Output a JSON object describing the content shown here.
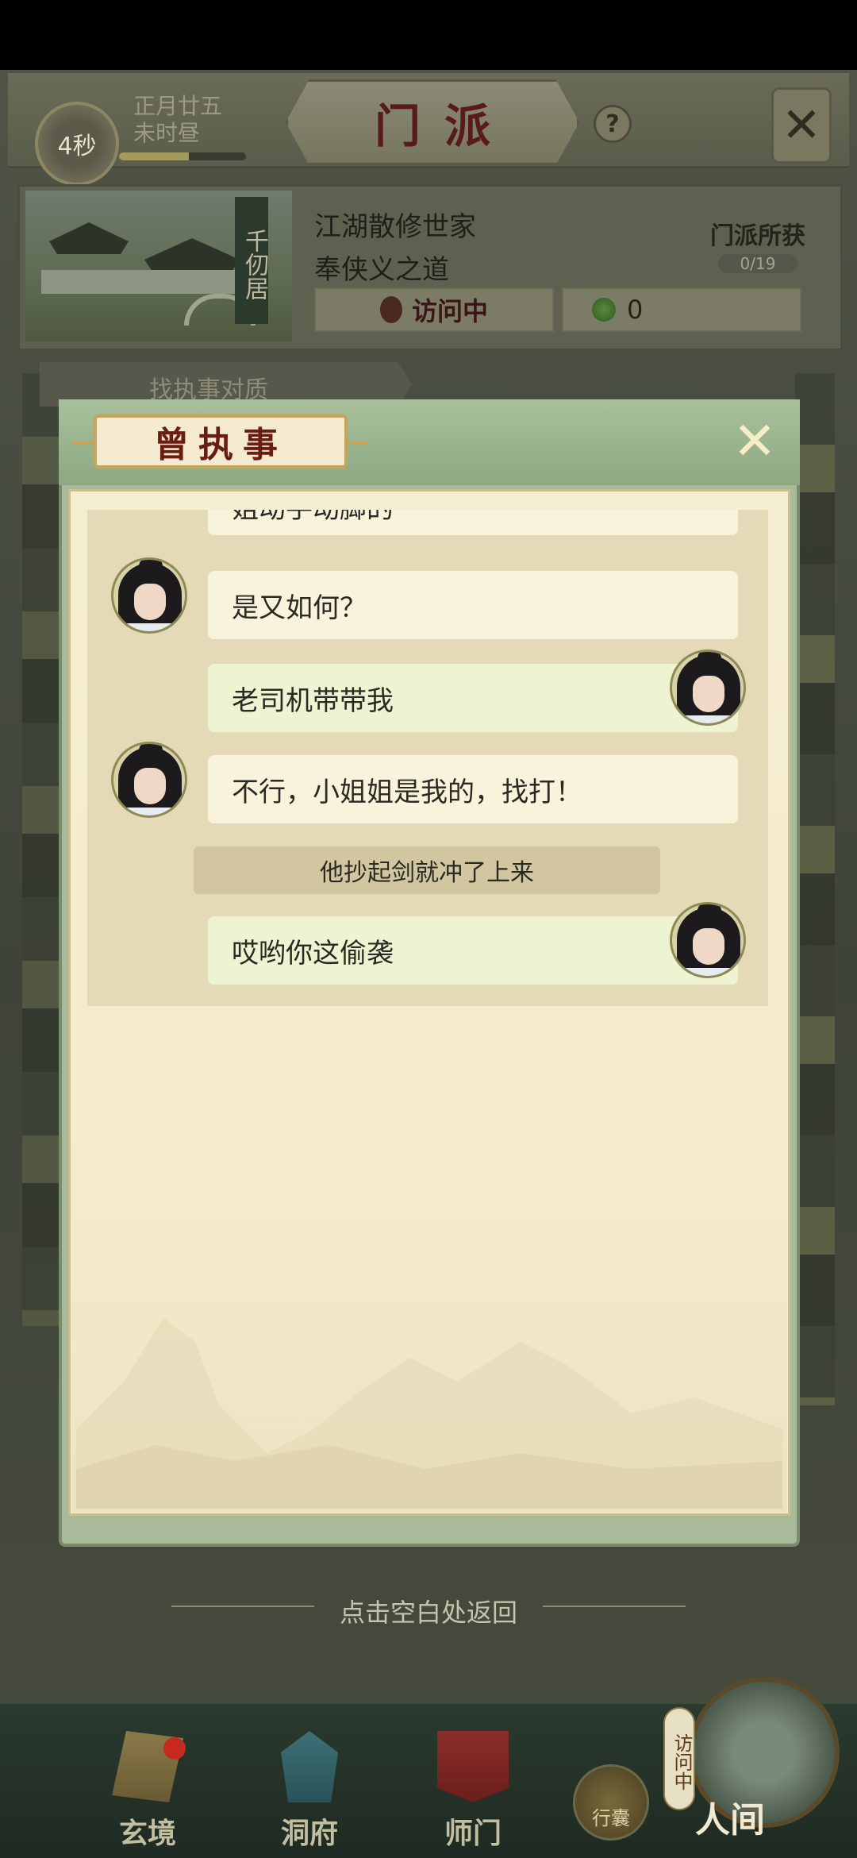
{
  "header": {
    "timer": "4秒",
    "date_line1": "正月廿五",
    "date_line2": "未时昼",
    "time_progress": 0.55,
    "title": "门派",
    "help": "?"
  },
  "sect": {
    "name": "千仞居",
    "desc1": "江湖散修世家",
    "desc2": "奉侠义之道",
    "visit_status": "访问中",
    "coins": "0",
    "gain_label": "门派所获",
    "gain_count": "0/19"
  },
  "task": {
    "text": "找执事对质"
  },
  "dialog": {
    "title": "曾执事",
    "messages": [
      {
        "speaker": "her",
        "text": "姐动手动脚的"
      },
      {
        "speaker": "her",
        "text": "是又如何？"
      },
      {
        "speaker": "him",
        "text": "老司机带带我"
      },
      {
        "speaker": "her",
        "text": "不行，小姐姐是我的，找打！"
      },
      {
        "speaker": "narration",
        "text": "他抄起剑就冲了上来"
      },
      {
        "speaker": "him",
        "text": "哎哟你这偷袭"
      }
    ]
  },
  "return_hint": "点击空白处返回",
  "bottom_nav": {
    "items": [
      {
        "label": "玄境",
        "icon": "scroll-icon"
      },
      {
        "label": "洞府",
        "icon": "tower-icon"
      },
      {
        "label": "师门",
        "icon": "banner-icon"
      }
    ],
    "bag_label": "行囊",
    "world_label": "人间",
    "visiting_tag": "访问中"
  },
  "colors": {
    "dialog_title": "#6a1d12",
    "visit_text": "#3c1616",
    "notification_dot": "#c62a1e"
  }
}
